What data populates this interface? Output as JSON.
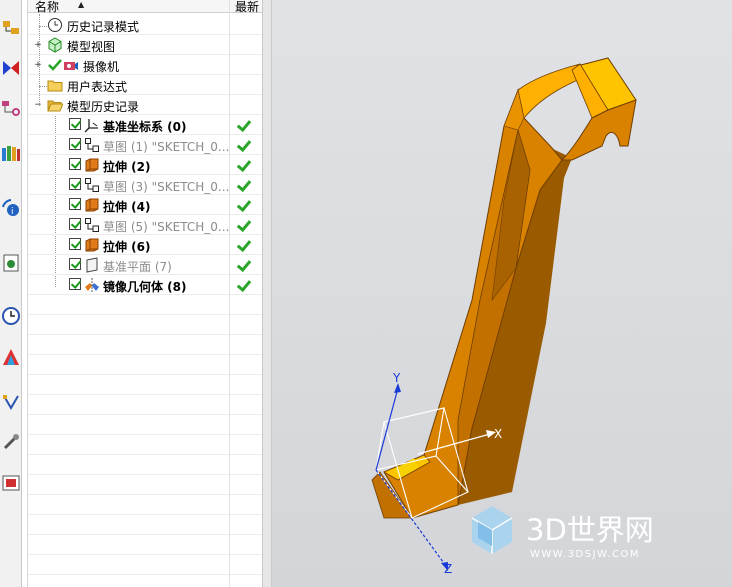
{
  "navigator": {
    "header": {
      "name": "名称",
      "latest": "最新"
    },
    "top_items": [
      {
        "label": "历史记录模式",
        "icon": "clock-icon"
      },
      {
        "label": "模型视图",
        "icon": "model-view-icon"
      },
      {
        "label": "摄像机",
        "icon": "camera-icon"
      },
      {
        "label": "用户表达式",
        "icon": "folder-icon"
      },
      {
        "label": "模型历史记录",
        "icon": "folder-open-icon"
      }
    ],
    "history": [
      {
        "label": "基准坐标系 (0)",
        "icon": "datum-csys-icon",
        "style": "bold",
        "latest": true
      },
      {
        "label": "草图 (1) \"SKETCH_0...",
        "icon": "sketch-icon",
        "style": "gray",
        "latest": true
      },
      {
        "label": "拉伸 (2)",
        "icon": "extrude-icon",
        "style": "bold",
        "latest": true
      },
      {
        "label": "草图 (3) \"SKETCH_0...",
        "icon": "sketch-icon",
        "style": "gray",
        "latest": true
      },
      {
        "label": "拉伸 (4)",
        "icon": "extrude-icon",
        "style": "bold",
        "latest": true
      },
      {
        "label": "草图 (5) \"SKETCH_0...",
        "icon": "sketch-icon",
        "style": "gray",
        "latest": true
      },
      {
        "label": "拉伸 (6)",
        "icon": "extrude-icon",
        "style": "bold",
        "latest": true
      },
      {
        "label": "基准平面 (7)",
        "icon": "datum-plane-icon",
        "style": "gray",
        "latest": true
      },
      {
        "label": "镜像几何体 (8)",
        "icon": "mirror-body-icon",
        "style": "bold",
        "latest": true
      }
    ]
  },
  "resource_bar": {
    "icons": [
      "assembly-navigator-icon",
      "constraint-navigator-icon",
      "part-navigator-icon",
      "reuse-library-icon",
      "hd3d-tools-icon",
      "web-browser-icon",
      "history-icon",
      "system-materials-icon",
      "process-studio-icon",
      "manufacturing-wizard-icon",
      "roles-icon"
    ]
  },
  "viewport": {
    "axes": {
      "x": "X",
      "y": "Y",
      "z": "Z"
    },
    "watermark": {
      "brand": "3D世界网",
      "url": "WWW.3DSJW.COM"
    }
  },
  "colors": {
    "model_face": "#d98200",
    "model_top": "#ffc400",
    "model_dark": "#9a5a00",
    "viewport_bg": "#d9dbdf",
    "axis_blue": "#1a3ad8",
    "check_green": "#2aa52a"
  }
}
